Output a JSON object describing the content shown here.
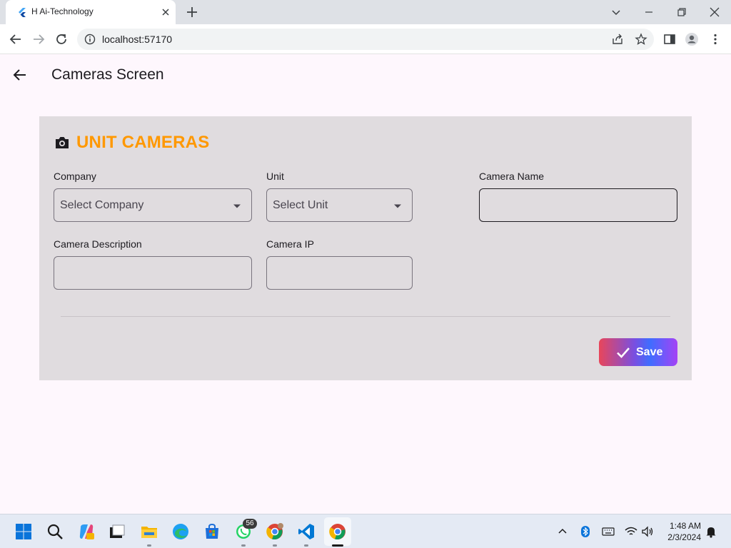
{
  "browser": {
    "tab_title": "H Ai-Technology",
    "url": "localhost:57170"
  },
  "appbar": {
    "title": "Cameras Screen"
  },
  "form": {
    "section_title": "UNIT CAMERAS",
    "company": {
      "label": "Company",
      "placeholder": "Select Company"
    },
    "unit": {
      "label": "Unit",
      "placeholder": "Select Unit"
    },
    "camera_name": {
      "label": "Camera Name",
      "value": ""
    },
    "camera_description": {
      "label": "Camera Description",
      "value": ""
    },
    "camera_ip": {
      "label": "Camera IP",
      "value": ""
    },
    "save_label": "Save"
  },
  "taskbar": {
    "whatsapp_badge": "56",
    "time": "1:48 AM",
    "date": "2/3/2024"
  },
  "colors": {
    "accent": "#ff9800",
    "background": "#fef7fd",
    "card": "#e0dcdf"
  }
}
